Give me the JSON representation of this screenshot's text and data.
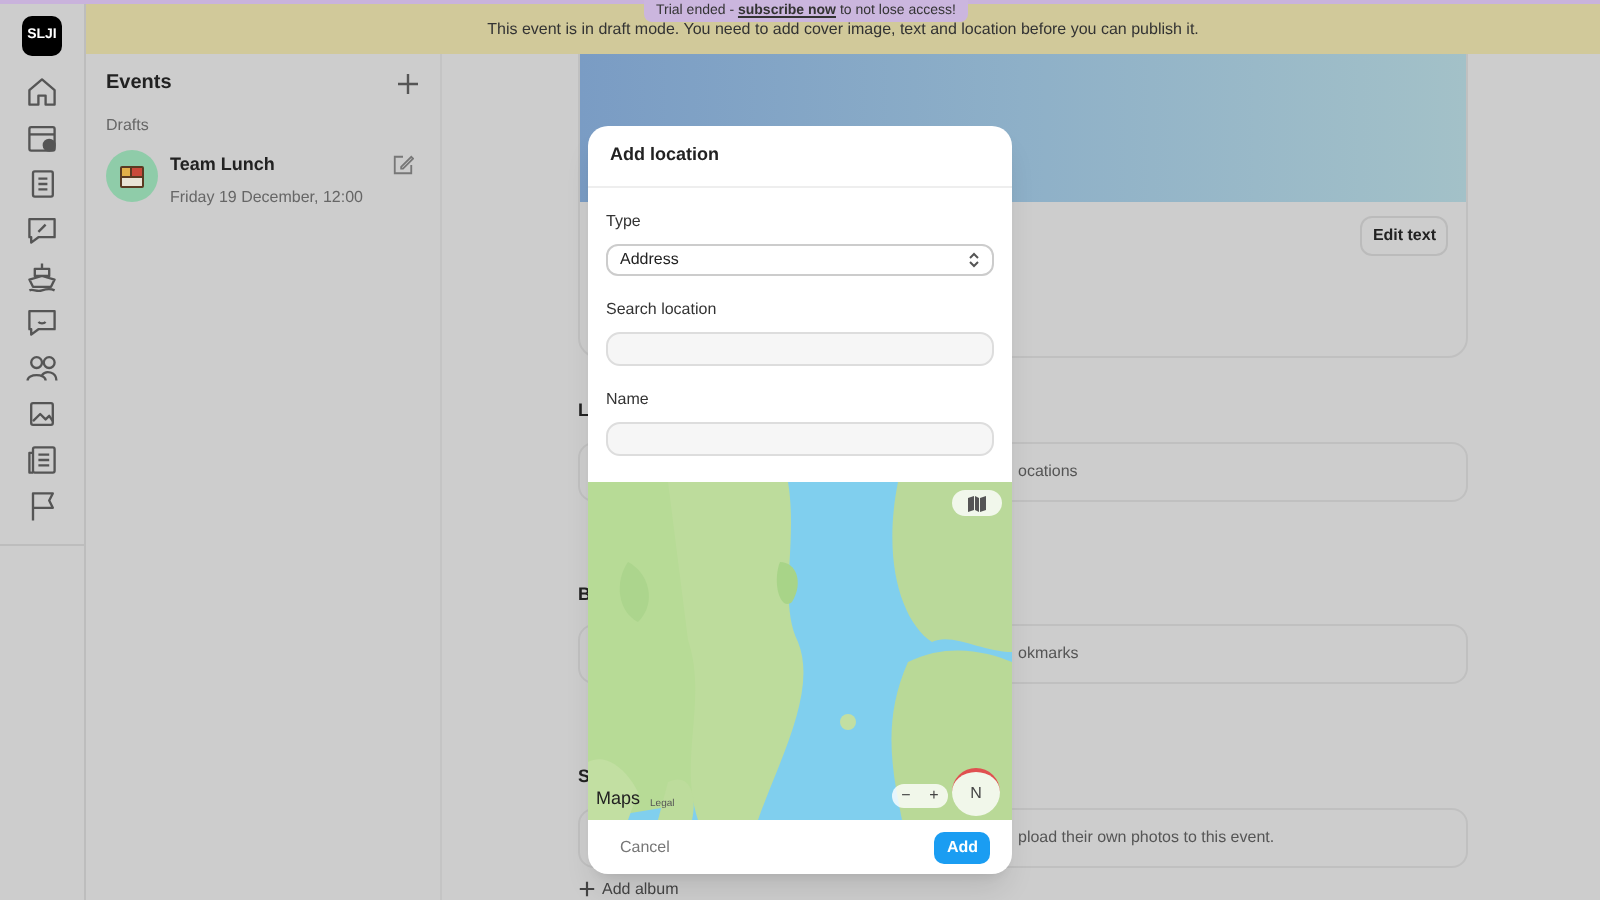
{
  "trial_banner": {
    "before": "Trial ended - ",
    "link": "subscribe now",
    "after": " to not lose access!"
  },
  "draft_banner": "This event is in draft mode. You need to add cover image, text and location before you can publish it.",
  "logo": "SLJI",
  "events_panel": {
    "title": "Events",
    "section": "Drafts",
    "events": [
      {
        "title": "Team Lunch",
        "date": "Friday 19 December, 12:00",
        "selected": false
      }
    ]
  },
  "main": {
    "edit_text": "Edit text",
    "sections": [
      {
        "heading": "L",
        "box_text": "ocations"
      },
      {
        "heading": "B",
        "box_text": "okmarks"
      },
      {
        "heading": "S",
        "box_text": "pload their own photos to this event."
      }
    ],
    "add_album": "Add album"
  },
  "modal": {
    "title": "Add location",
    "fields": [
      {
        "kind": "select",
        "label": "Type",
        "value": "Address"
      },
      {
        "kind": "input",
        "label": "Search location"
      },
      {
        "kind": "input",
        "label": "Name"
      }
    ],
    "map": {
      "kind": "picture",
      "attribution": "Maps",
      "legal": "Legal",
      "zoom_out": "−",
      "zoom_in": "+",
      "compass": "N"
    },
    "cancel": "Cancel",
    "add": "Add"
  }
}
